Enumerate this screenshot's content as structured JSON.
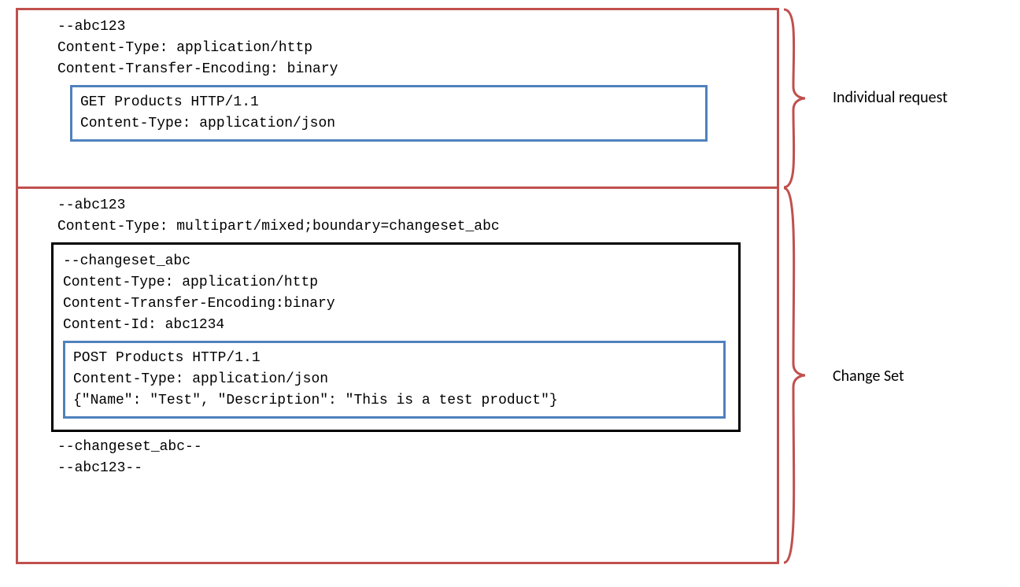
{
  "labels": {
    "individual_request": "Individual request",
    "change_set": "Change Set"
  },
  "box1": {
    "line1": "--abc123",
    "line2": "Content-Type: application/http",
    "line3": "Content-Transfer-Encoding: binary",
    "inner": {
      "line1": "GET Products HTTP/1.1",
      "line2": "Content-Type: application/json"
    }
  },
  "box2": {
    "line1": "--abc123",
    "line2": "Content-Type: multipart/mixed;boundary=changeset_abc",
    "black_box": {
      "line1": "--changeset_abc",
      "line2": "Content-Type: application/http",
      "line3": "Content-Transfer-Encoding:binary",
      "line4": "Content-Id: abc1234",
      "inner": {
        "line1": "POST Products HTTP/1.1",
        "line2": "Content-Type: application/json",
        "line3": "",
        "line4": "{\"Name\": \"Test\", \"Description\": \"This is a test product\"}"
      }
    },
    "line3": "--changeset_abc--",
    "line4": "--abc123--"
  }
}
